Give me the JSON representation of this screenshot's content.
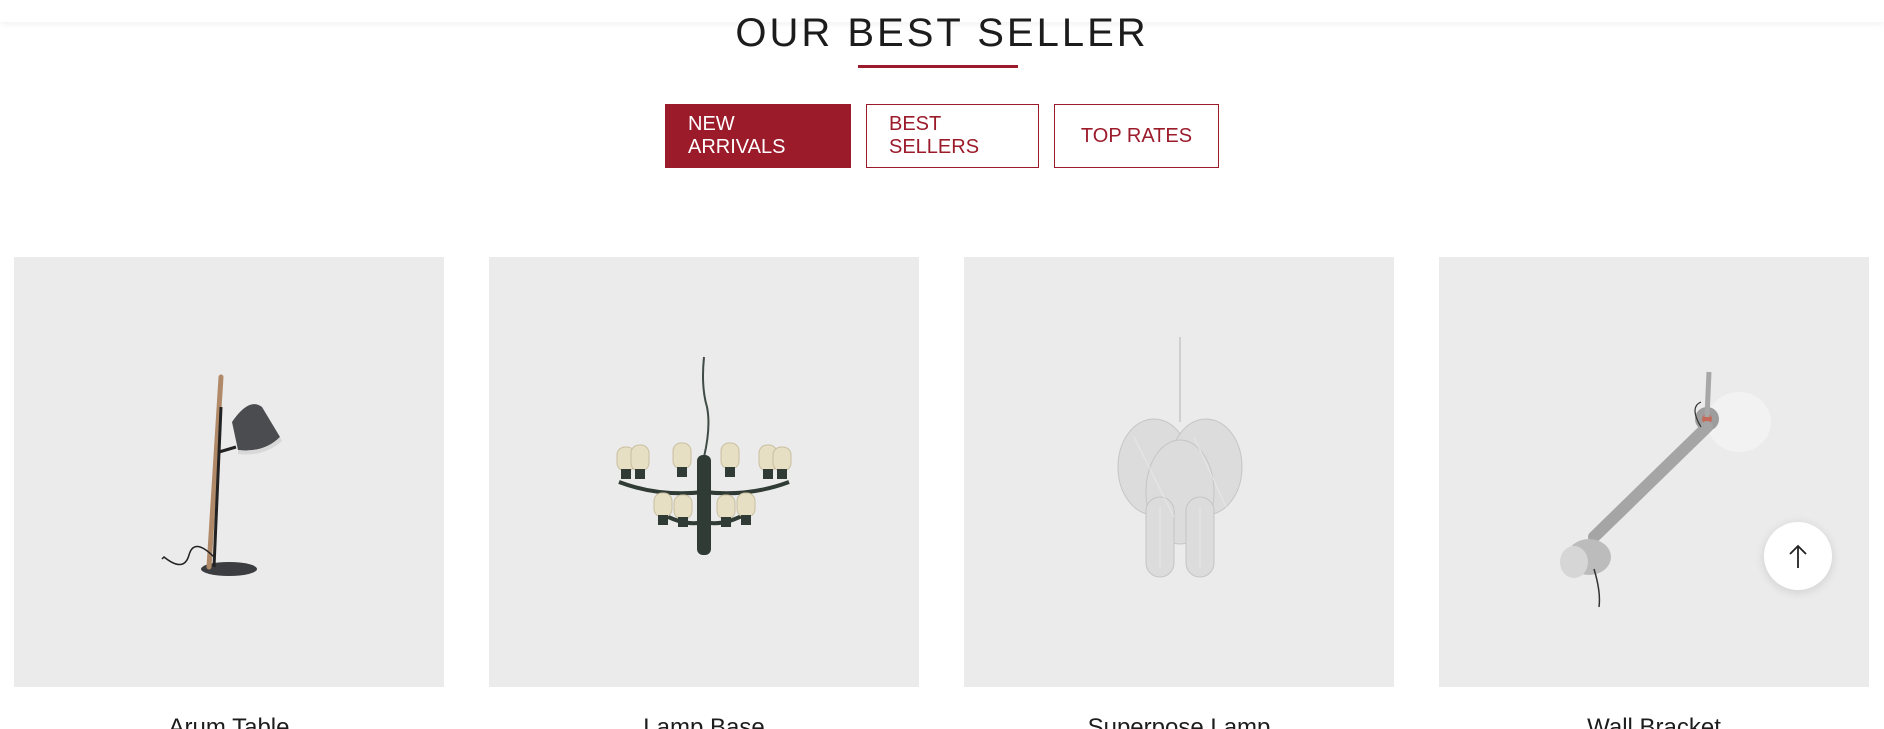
{
  "section": {
    "title": "OUR BEST SELLER"
  },
  "tabs": [
    {
      "label": "NEW ARRIVALS",
      "active": true
    },
    {
      "label": "BEST SELLERS",
      "active": false
    },
    {
      "label": "TOP RATES",
      "active": false
    }
  ],
  "products": [
    {
      "name": "Arum Table",
      "image_icon": "floor-lamp-icon"
    },
    {
      "name": "Lamp Base",
      "image_icon": "chandelier-icon"
    },
    {
      "name": "Superpose Lamp",
      "image_icon": "pendant-lamp-icon"
    },
    {
      "name": "Wall Bracket",
      "image_icon": "wall-lamp-icon"
    }
  ],
  "scroll_top": {
    "icon": "arrow-up-icon"
  },
  "colors": {
    "accent": "#9c1b2b",
    "card_bg": "#ebebeb",
    "text": "#1c1c1c"
  }
}
